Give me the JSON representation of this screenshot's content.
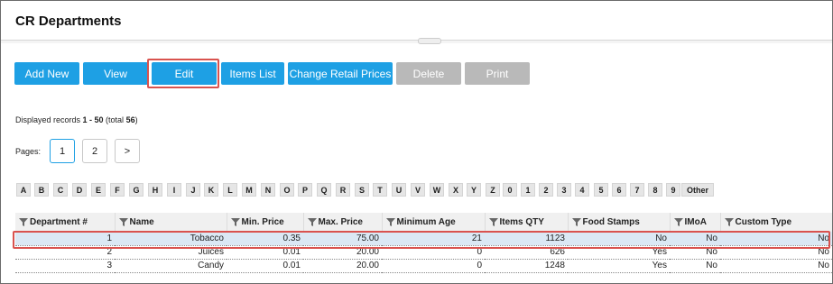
{
  "page": {
    "title": "CR Departments"
  },
  "toolbar": {
    "buttons": [
      {
        "label": "Add New",
        "style": "blue"
      },
      {
        "label": "View",
        "style": "blue"
      },
      {
        "label": "Edit",
        "style": "blue"
      },
      {
        "label": "Items List",
        "style": "blue"
      },
      {
        "label": "Change Retail Prices",
        "style": "blue"
      },
      {
        "label": "Delete",
        "style": "gray"
      },
      {
        "label": "Print",
        "style": "gray"
      }
    ]
  },
  "records": {
    "prefix": "Displayed records ",
    "range": "1 - 50",
    "mid": " (total ",
    "total": "56",
    "suffix": ")"
  },
  "pagination": {
    "label": "Pages:",
    "pages": [
      "1",
      "2"
    ],
    "next": ">"
  },
  "letters": [
    "A",
    "B",
    "C",
    "D",
    "E",
    "F",
    "G",
    "H",
    "I",
    "J",
    "K",
    "L",
    "M",
    "N",
    "O",
    "P",
    "Q",
    "R",
    "S",
    "T",
    "U",
    "V",
    "W",
    "X",
    "Y",
    "Z",
    "0",
    "1",
    "2",
    "3",
    "4",
    "5",
    "6",
    "7",
    "8",
    "9"
  ],
  "other_label": "Other",
  "table": {
    "columns": [
      "Department #",
      "Name",
      "Min. Price",
      "Max. Price",
      "Minimum Age",
      "Items QTY",
      "Food Stamps",
      "IMoA",
      "Custom Type"
    ],
    "rows": [
      [
        "1",
        "Tobacco",
        "0.35",
        "75.00",
        "21",
        "1123",
        "No",
        "No",
        "No"
      ],
      [
        "2",
        "Juices",
        "0.01",
        "20.00",
        "0",
        "626",
        "Yes",
        "No",
        "No"
      ],
      [
        "3",
        "Candy",
        "0.01",
        "20.00",
        "0",
        "1248",
        "Yes",
        "No",
        "No"
      ]
    ]
  },
  "colors": {
    "accent": "#1ea0e4",
    "disabled": "#b9b9b9",
    "highlight": "#d9534f",
    "selected_row": "#dbe8f4"
  }
}
